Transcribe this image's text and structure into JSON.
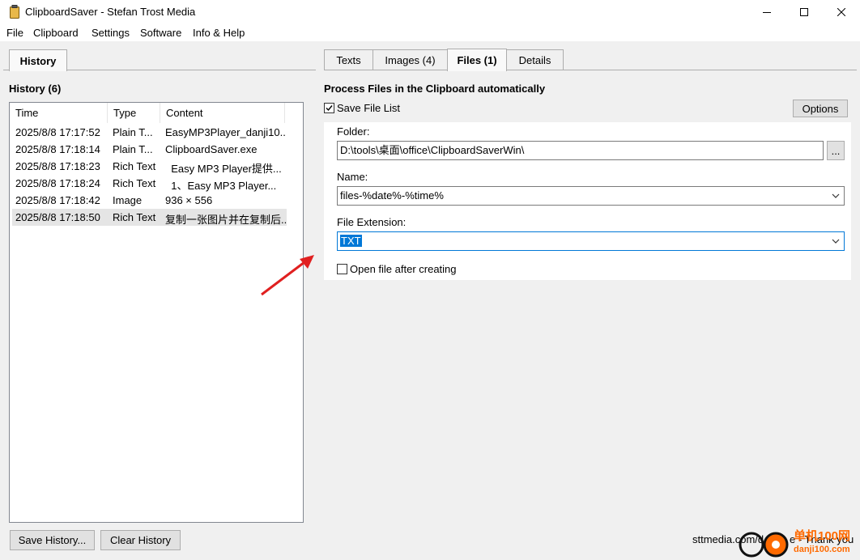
{
  "window": {
    "title": "ClipboardSaver - Stefan Trost Media"
  },
  "menu": {
    "items": [
      "File",
      "Clipboard",
      "Settings",
      "Software",
      "Info & Help"
    ]
  },
  "left_tabs": {
    "history": "History"
  },
  "right_tabs": [
    {
      "label": "Texts"
    },
    {
      "label": "Images (4)"
    },
    {
      "label": "Files (1)"
    },
    {
      "label": "Details"
    }
  ],
  "history": {
    "heading": "History (6)",
    "columns": [
      "Time",
      "Type",
      "Content"
    ],
    "rows": [
      {
        "time": "2025/8/8 17:17:52",
        "type": "Plain T...",
        "content": "EasyMP3Player_danji10..."
      },
      {
        "time": "2025/8/8 17:18:14",
        "type": "Plain T...",
        "content": "ClipboardSaver.exe"
      },
      {
        "time": "2025/8/8 17:18:23",
        "type": "Rich Text",
        "content": "  Easy MP3 Player提供..."
      },
      {
        "time": "2025/8/8 17:18:24",
        "type": "Rich Text",
        "content": "  1、Easy MP3 Player..."
      },
      {
        "time": "2025/8/8 17:18:42",
        "type": "Image",
        "content": "936 × 556"
      },
      {
        "time": "2025/8/8 17:18:50",
        "type": "Rich Text",
        "content": "复制一张图片并在复制后..."
      }
    ],
    "save_button": "Save History...",
    "clear_button": "Clear History"
  },
  "files": {
    "heading": "Process Files in the Clipboard automatically",
    "save_file_list_label": "Save File List",
    "save_file_list_checked": true,
    "options_button": "Options",
    "folder_label": "Folder:",
    "folder_value": "D:\\tools\\桌面\\office\\ClipboardSaverWin\\",
    "browse_button": "...",
    "name_label": "Name:",
    "name_value": "files-%date%-%time%",
    "extension_label": "File Extension:",
    "extension_value": "TXT",
    "open_after_label": "Open file after creating",
    "open_after_checked": false
  },
  "status": {
    "left": "sttmedia.com/d",
    "right": "e - Thank you"
  },
  "watermark": {
    "cn": "单机100网",
    "domain": "danji100.com"
  },
  "colors": {
    "accent": "#0078d7",
    "arrow": "#e02020",
    "watermark_orange": "#ff6a00"
  }
}
